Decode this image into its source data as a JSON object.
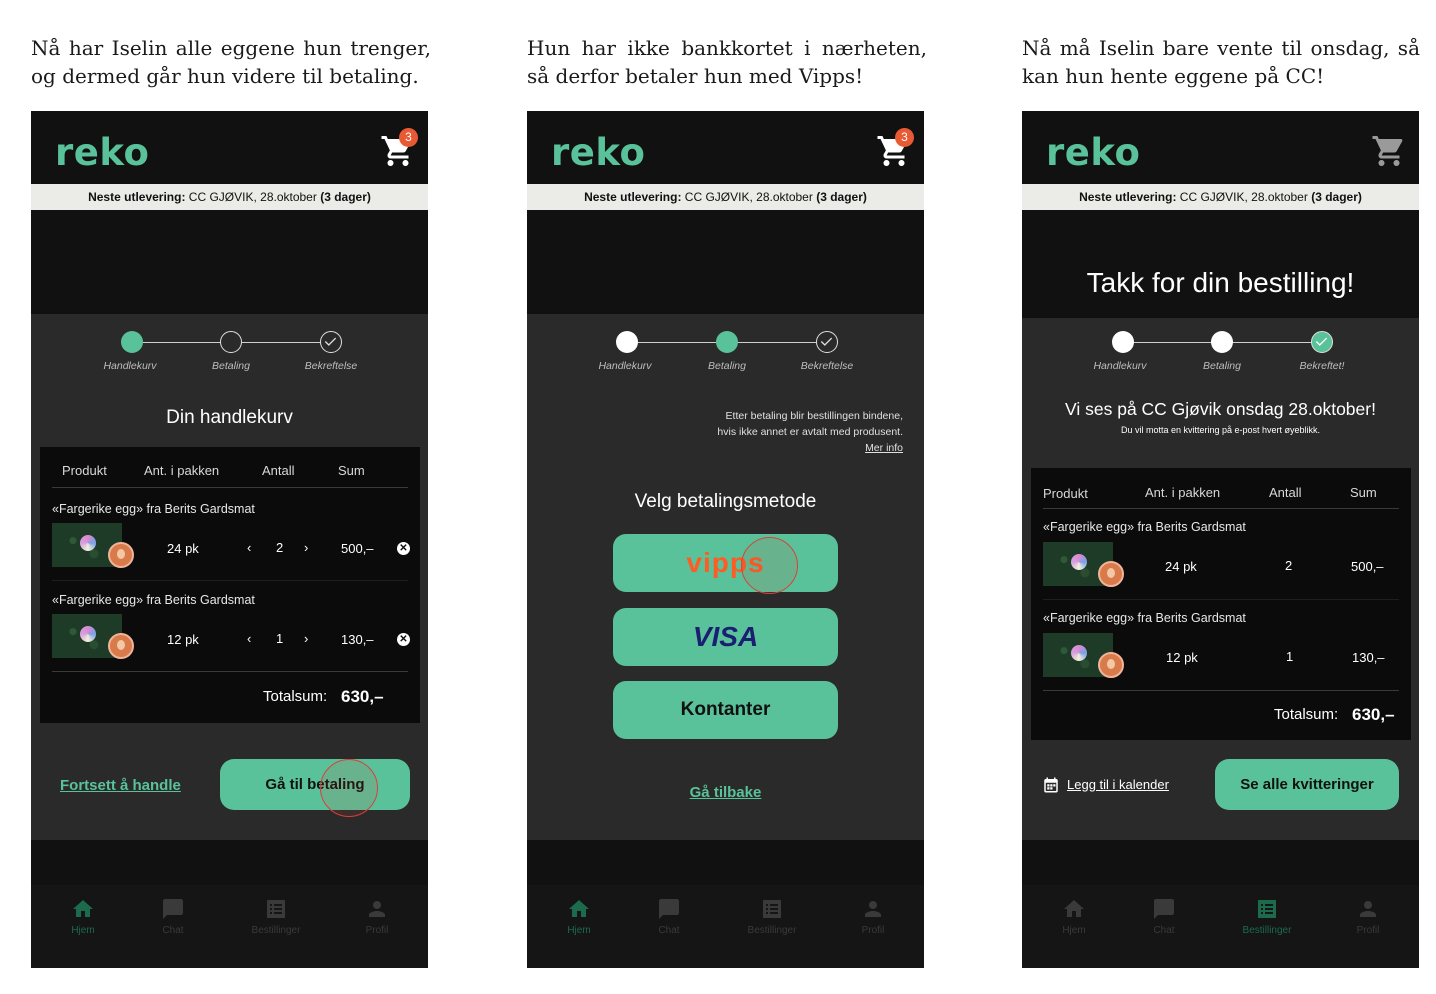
{
  "captions": [
    "Nå har Iselin alle eggene hun trenger, og dermed går hun videre til betaling.",
    "Hun har ikke bankkortet i nærheten, så derfor betaler hun med Vipps!",
    "Nå må Iselin bare vente til onsdag, så kan hun hente eggene på CC!"
  ],
  "app": {
    "logo": "reko",
    "cart_count": "3",
    "delivery": {
      "label": "Neste utlevering:",
      "place": "CC GJØVIK, 28.oktober",
      "days": "(3 dager)"
    },
    "nav": [
      "Hjem",
      "Chat",
      "Bestillinger",
      "Profil"
    ]
  },
  "steps": {
    "cart": "Handlekurv",
    "payment": "Betaling",
    "confirm": "Bekreftelse",
    "confirmed": "Bekreftet!"
  },
  "screen1": {
    "title": "Din handlekurv",
    "headers": [
      "Produkt",
      "Ant. i pakken",
      "Antall",
      "Sum"
    ],
    "items": [
      {
        "name": "«Fargerike egg» fra Berits Gardsmat",
        "pack": "24 pk",
        "qty": "2",
        "sum": "500,–"
      },
      {
        "name": "«Fargerike egg» fra Berits Gardsmat",
        "pack": "12 pk",
        "qty": "1",
        "sum": "130,–"
      }
    ],
    "total_label": "Totalsum:",
    "total_value": "630,–",
    "continue_link": "Fortsett å handle",
    "checkout_button": "Gå til betaling"
  },
  "screen2": {
    "notice_line1": "Etter betaling blir bestillingen bindene,",
    "notice_line2": "hvis ikke annet er avtalt med produsent.",
    "more_info": "Mer info",
    "title": "Velg betalingsmetode",
    "vipps": "vipps",
    "visa": "VISA",
    "cash": "Kontanter",
    "back_link": "Gå tilbake"
  },
  "screen3": {
    "title": "Takk for din bestilling!",
    "subtitle": "Vi ses på CC Gjøvik onsdag 28.oktober!",
    "note": "Du vil motta en kvittering på e-post hvert øyeblikk.",
    "headers": [
      "Produkt",
      "Ant. i pakken",
      "Antall",
      "Sum"
    ],
    "items": [
      {
        "name": "«Fargerike egg» fra Berits Gardsmat",
        "pack": "24 pk",
        "qty": "2",
        "sum": "500,–"
      },
      {
        "name": "«Fargerike egg» fra Berits Gardsmat",
        "pack": "12 pk",
        "qty": "1",
        "sum": "130,–"
      }
    ],
    "total_label": "Totalsum:",
    "total_value": "630,–",
    "calendar_link": "Legg til i kalender",
    "receipts_button": "Se alle kvitteringer"
  },
  "colors": {
    "brand": "#5ac29a",
    "background": "#2a2a2a",
    "header": "#111111",
    "badge": "#e85a33",
    "vipps": "#ff5b24",
    "visa": "#1a1f71"
  }
}
